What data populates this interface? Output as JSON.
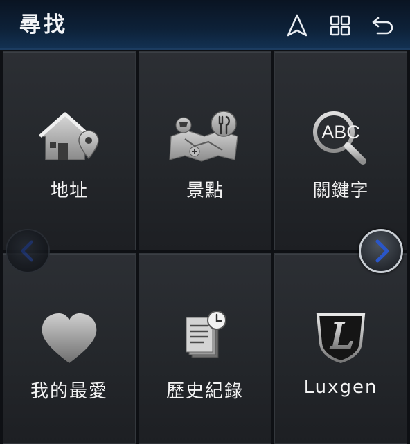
{
  "header": {
    "title": "尋找",
    "icons": [
      "navigation-arrow-icon",
      "grid-icon",
      "back-icon"
    ]
  },
  "tiles": [
    {
      "label": "地址",
      "icon": "house-pin-icon"
    },
    {
      "label": "景點",
      "icon": "map-poi-icon"
    },
    {
      "label": "關鍵字",
      "icon": "magnifier-abc-icon"
    },
    {
      "label": "我的最愛",
      "icon": "heart-icon"
    },
    {
      "label": "歷史紀錄",
      "icon": "history-document-icon"
    },
    {
      "label": "Luxgen",
      "icon": "luxgen-logo-icon"
    }
  ],
  "keyword_icon_text": "ABC",
  "pager": {
    "prev": "chevron-left-icon",
    "next": "chevron-right-icon"
  },
  "colors": {
    "header_top": "#0a1422",
    "header_bottom": "#133152",
    "tile": "#26292d",
    "accent_blue": "#2a4fb8"
  }
}
